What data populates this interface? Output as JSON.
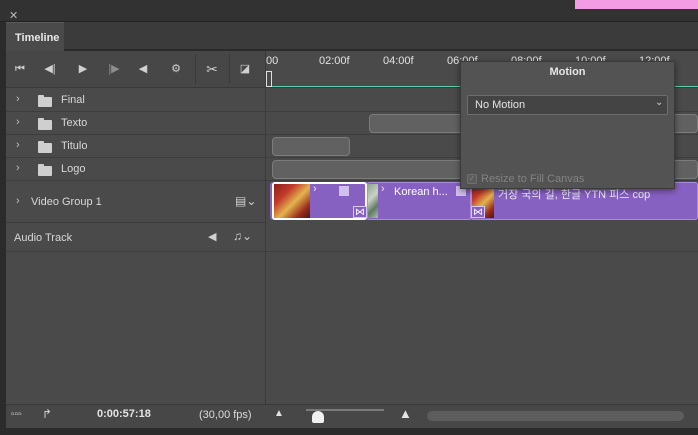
{
  "panel": {
    "tab_label": "Timeline"
  },
  "toolbar": {
    "go_to_first_icon": "skip-back-icon",
    "prev_frame_icon": "step-back-icon",
    "play_icon": "play-icon",
    "next_frame_icon": "step-forward-icon",
    "audio_icon": "speaker-icon",
    "settings_icon": "gear-icon",
    "split_icon": "scissors-icon",
    "transition_icon": "transition-icon"
  },
  "ruler": {
    "ticks": [
      "00",
      "02:00f",
      "04:00f",
      "06:00f",
      "08:00f",
      "10:00f",
      "12:00f"
    ]
  },
  "tracks": [
    {
      "label": "Final"
    },
    {
      "label": "Texto"
    },
    {
      "label": "Titulo"
    },
    {
      "label": "Logo"
    }
  ],
  "video_group": {
    "label": "Video Group 1",
    "clip2_title": "Korean h...",
    "clip3_title": "거장 국의 길, 한글 YTN 피스 cop"
  },
  "audio_track": {
    "label": "Audio Track"
  },
  "motion_popup": {
    "title": "Motion",
    "select_value": "No Motion",
    "checkbox_label": "Resize to Fill Canvas",
    "checkbox_checked": true,
    "checkbox_enabled": false
  },
  "status": {
    "timecode": "0:00:57:18",
    "fps": "(30,00 fps)"
  },
  "colors": {
    "accent_purple": "#8761c2",
    "ruler_work_area": "#5bd0b3",
    "window_pink": "#f39ce3"
  }
}
